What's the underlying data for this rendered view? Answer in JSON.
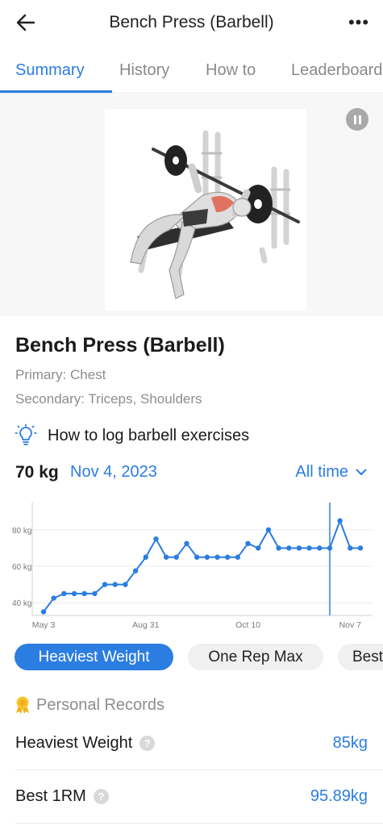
{
  "header": {
    "title": "Bench Press (Barbell)",
    "back_icon": "arrow-left-icon",
    "more_icon": "more-horizontal-icon",
    "more_glyph": "•••"
  },
  "tabs": [
    {
      "label": "Summary",
      "active": true
    },
    {
      "label": "History",
      "active": false
    },
    {
      "label": "How to",
      "active": false
    },
    {
      "label": "Leaderboard",
      "active": false
    }
  ],
  "exercise": {
    "name": "Bench Press (Barbell)",
    "primary": "Primary: Chest",
    "secondary": "Secondary: Triceps, Shoulders"
  },
  "howto": {
    "text": "How to log barbell exercises",
    "icon": "lightbulb-icon"
  },
  "summary": {
    "value": "70 kg",
    "date": "Nov 4, 2023",
    "range": "All time"
  },
  "chart_data": {
    "type": "line",
    "ylabels": [
      "80 kg",
      "60 kg",
      "40 kg"
    ],
    "yticks": [
      80,
      60,
      40
    ],
    "ylim": [
      33,
      95
    ],
    "x_ticks": [
      {
        "label": "May 3",
        "index": 0
      },
      {
        "label": "Aug 31",
        "index": 10
      },
      {
        "label": "Oct 10",
        "index": 20
      },
      {
        "label": "Nov 7",
        "index": 30
      }
    ],
    "values": [
      35,
      42.5,
      45,
      45,
      45,
      45,
      50,
      50,
      50,
      57.5,
      65,
      75,
      65,
      65,
      72.5,
      65,
      65,
      65,
      65,
      65,
      72.5,
      70,
      80,
      70,
      70,
      70,
      70,
      70,
      70,
      85,
      70,
      70
    ],
    "highlight_index": 28,
    "color": "#2b7de1",
    "grid": true
  },
  "metric_pills": [
    {
      "label": "Heaviest Weight",
      "active": true
    },
    {
      "label": "One Rep Max",
      "active": false
    },
    {
      "label": "Best Set Volume",
      "active": false
    }
  ],
  "records": {
    "title": "Personal Records",
    "icon": "medal-icon",
    "items": [
      {
        "label": "Heaviest Weight",
        "value": "85kg"
      },
      {
        "label": "Best 1RM",
        "value": "95.89kg"
      }
    ]
  },
  "colors": {
    "accent": "#2b7de1",
    "muted_text": "#8d8d8d",
    "pill_bg": "#f0f0f0"
  }
}
